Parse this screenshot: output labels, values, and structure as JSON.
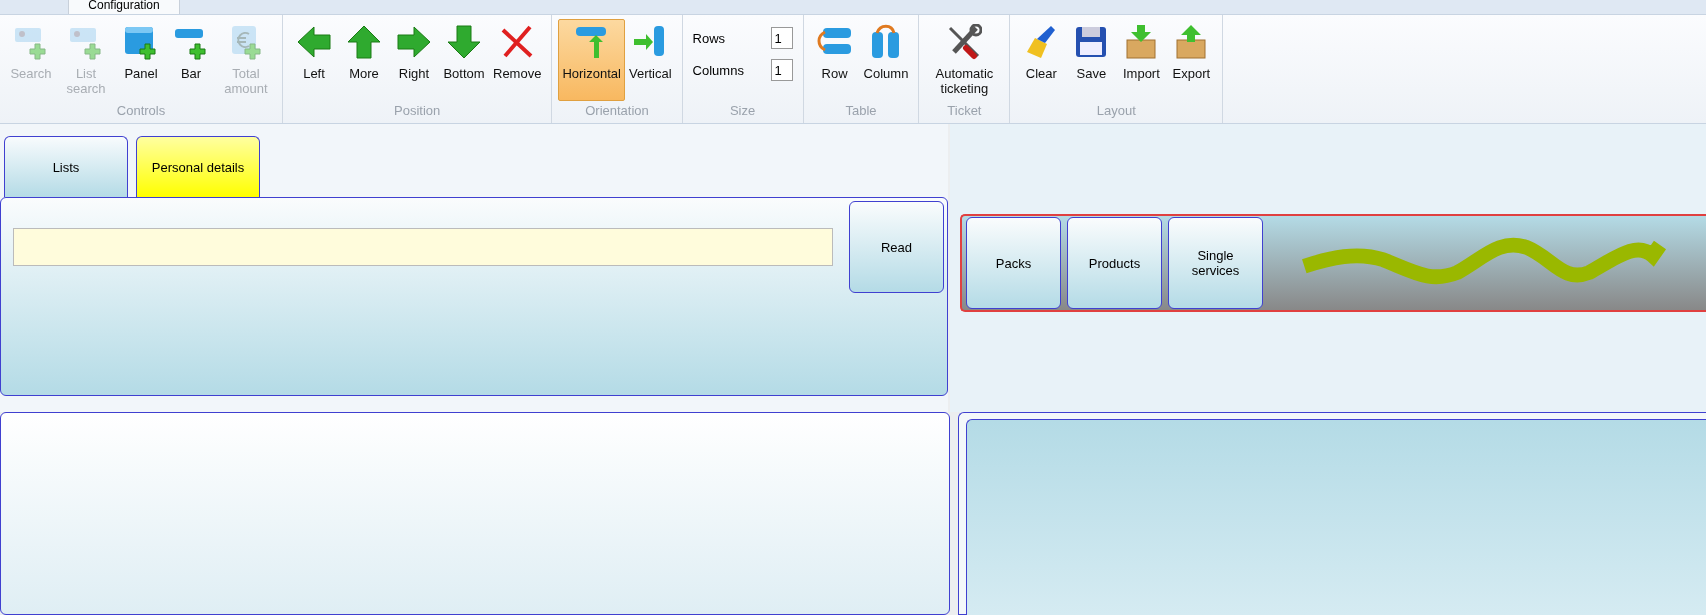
{
  "ribbon_tabs": [
    {
      "label": "Configuration",
      "selected": true
    }
  ],
  "ribbon_groups": [
    {
      "label": "Controls",
      "items": [
        {
          "label": "Search",
          "disabled": true
        },
        {
          "label": "List search",
          "disabled": true
        },
        {
          "label": "Panel",
          "disabled": false
        },
        {
          "label": "Bar",
          "disabled": false
        },
        {
          "label": "Total amount",
          "disabled": true
        }
      ]
    },
    {
      "label": "Position",
      "items": [
        {
          "label": "Left",
          "disabled": false
        },
        {
          "label": "More",
          "disabled": false
        },
        {
          "label": "Right",
          "disabled": false
        },
        {
          "label": "Bottom",
          "disabled": false
        },
        {
          "label": "Remove",
          "disabled": false
        }
      ]
    },
    {
      "label": "Orientation",
      "items": [
        {
          "label": "Horizontal",
          "selected": true
        },
        {
          "label": "Vertical",
          "selected": false
        }
      ]
    },
    {
      "label": "Size",
      "fields": [
        {
          "label": "Rows",
          "value": "1"
        },
        {
          "label": "Columns",
          "value": "1"
        }
      ]
    },
    {
      "label": "Table",
      "items": [
        {
          "label": "Row",
          "disabled": false
        },
        {
          "label": "Column",
          "disabled": false
        }
      ]
    },
    {
      "label": "Ticket",
      "items": [
        {
          "label": "Automatic ticketing",
          "disabled": false
        }
      ]
    },
    {
      "label": "Layout",
      "items": [
        {
          "label": "Clear",
          "disabled": false
        },
        {
          "label": "Save",
          "disabled": false
        },
        {
          "label": "Import",
          "disabled": false
        },
        {
          "label": "Export",
          "disabled": false
        }
      ]
    }
  ],
  "panel_tabs": [
    {
      "label": "Lists",
      "selected": false
    },
    {
      "label": "Personal details",
      "selected": true
    }
  ],
  "read_button": "Read",
  "category_buttons": [
    "Packs",
    "Products",
    "Single services"
  ]
}
